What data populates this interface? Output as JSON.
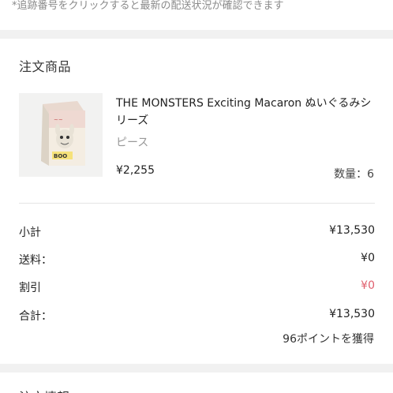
{
  "tracking_note": "*追跡番号をクリックすると最新の配送状況が確認できます",
  "order": {
    "section_title": "注文商品",
    "product": {
      "image_label": "product-thumbnail",
      "name": "THE MONSTERS Exciting Macaron ぬいぐるみシリーズ",
      "variant": "ピース",
      "price": "¥2,255",
      "quantity": "数量：6"
    },
    "summary": {
      "subtotal_label": "小計",
      "subtotal_value": "¥13,530",
      "shipping_label": "送料：",
      "shipping_value": "¥0",
      "discount_label": "割引",
      "discount_value": "¥0",
      "total_label": "合計：",
      "total_value": "¥13,530",
      "points": "96ポイントを獲得"
    }
  },
  "next_section_title": "注文情報",
  "colors": {
    "discount": "#e0606e",
    "separator": "#f1f1f1"
  }
}
